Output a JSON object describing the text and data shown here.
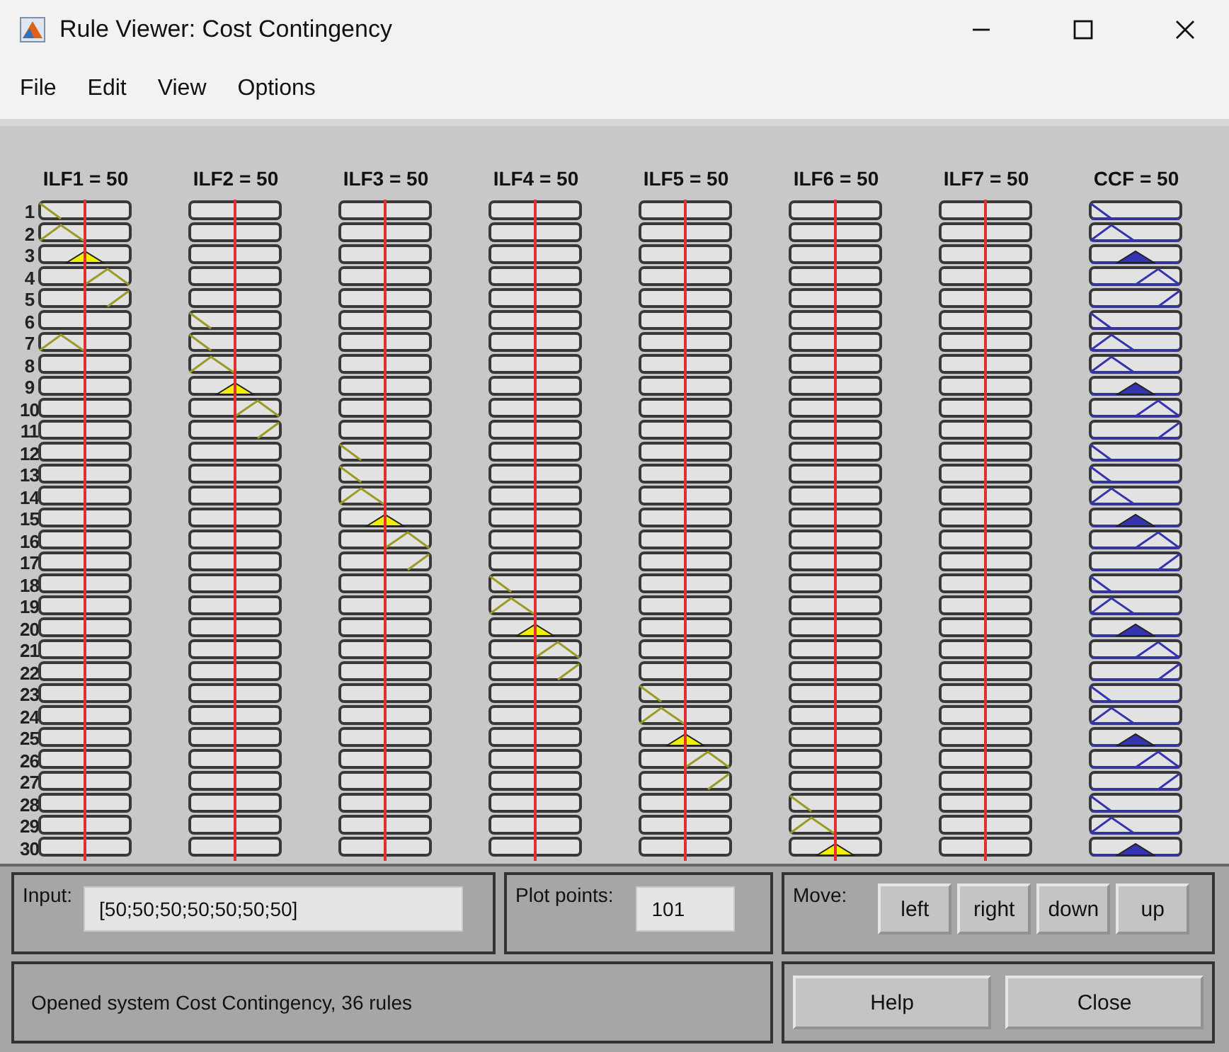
{
  "window": {
    "title": "Rule Viewer: Cost Contingency"
  },
  "menu": [
    "File",
    "Edit",
    "View",
    "Options"
  ],
  "columns": [
    {
      "label": "ILF1 = 50",
      "kind": "input"
    },
    {
      "label": "ILF2 = 50",
      "kind": "input"
    },
    {
      "label": "ILF3 = 50",
      "kind": "input"
    },
    {
      "label": "ILF4 = 50",
      "kind": "input"
    },
    {
      "label": "ILF5 = 50",
      "kind": "input"
    },
    {
      "label": "ILF6 = 50",
      "kind": "input"
    },
    {
      "label": "ILF7 = 50",
      "kind": "input"
    },
    {
      "label": "CCF = 50",
      "kind": "output"
    }
  ],
  "rule_numbers": [
    "1",
    "2",
    "3",
    "4",
    "5",
    "6",
    "7",
    "8",
    "9",
    "10",
    "11",
    "12",
    "13",
    "14",
    "15",
    "16",
    "17",
    "18",
    "19",
    "20",
    "21",
    "22",
    "23",
    "24",
    "25",
    "26",
    "27",
    "28",
    "29",
    "30"
  ],
  "input": {
    "label": "Input:",
    "value": "[50;50;50;50;50;50;50]"
  },
  "plot_points": {
    "label": "Plot points:",
    "value": "101"
  },
  "move": {
    "label": "Move:",
    "buttons": [
      "left",
      "right",
      "down",
      "up"
    ]
  },
  "status": "Opened system Cost Contingency, 36 rules",
  "buttons": [
    "Help",
    "Close"
  ]
}
